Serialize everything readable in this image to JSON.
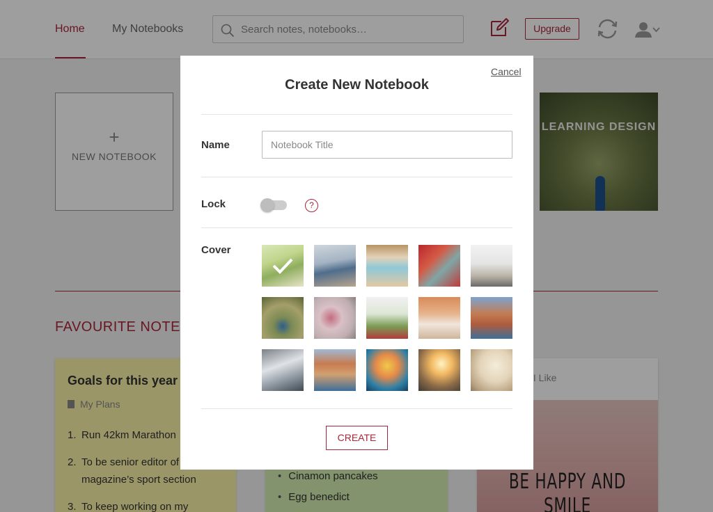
{
  "header": {
    "tabs": [
      {
        "label": "Home",
        "active": true
      },
      {
        "label": "My Notebooks",
        "active": false
      }
    ],
    "search": {
      "placeholder": "Search notes, notebooks…",
      "value": ""
    },
    "upgrade_label": "Upgrade",
    "icons": [
      "new-note-icon",
      "sync-icon",
      "user-icon",
      "chevron-down-icon"
    ]
  },
  "notebooks": {
    "new_label": "NEW NOTEBOOK",
    "new_plus": "+",
    "items": [
      {
        "title": "LEARNING DESIGN"
      }
    ]
  },
  "favourites": {
    "title": "FAVOURITE NOTES",
    "notes": [
      {
        "title": "Goals for this year",
        "notebook": "My Plans",
        "items": [
          {
            "num": "1.",
            "text": "Run 42km Marathon"
          },
          {
            "num": "2.",
            "text": "To be senior editor of magazine’s  sport section"
          },
          {
            "num": "3.",
            "text": "To keep working on my"
          }
        ]
      },
      {
        "items": [
          "Cinamon pancakes",
          "Egg benedict"
        ]
      },
      {
        "title_fragment": "s I Like",
        "image_text": "BE HAPPY AND SMILE"
      }
    ]
  },
  "modal": {
    "title": "Create New Notebook",
    "cancel_label": "Cancel",
    "name_label": "Name",
    "name_placeholder": "Notebook Title",
    "lock_label": "Lock",
    "lock_on": false,
    "help_glyph": "?",
    "cover_label": "Cover",
    "selected_cover_index": 0,
    "create_label": "CREATE"
  },
  "colors": {
    "accent": "#a8263a",
    "overlay": "rgba(0,0,0,0.38)"
  }
}
